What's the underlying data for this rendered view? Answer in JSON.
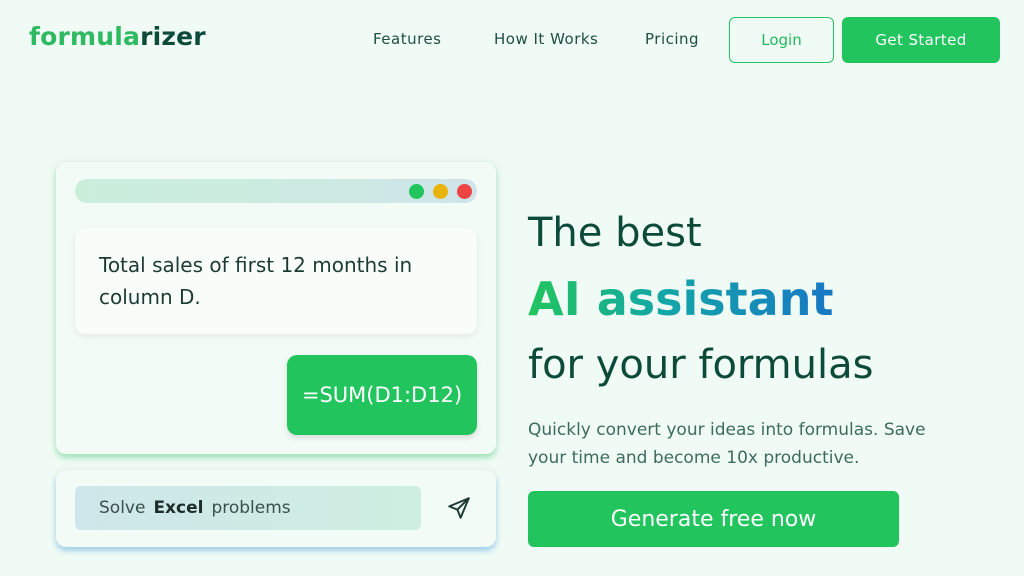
{
  "brand": {
    "part1": "formula",
    "part2": "rizer"
  },
  "nav": {
    "links": [
      "Features",
      "How It Works",
      "Pricing"
    ],
    "login": "Login",
    "get_started": "Get Started"
  },
  "demo": {
    "window_dots": [
      "#22c45e",
      "#eab308",
      "#ef4444"
    ],
    "question": "Total sales of first 12 months in column D.",
    "answer": "=SUM(D1:D12)",
    "input_prefix": "Solve",
    "input_keyword": "Excel",
    "input_suffix": "problems",
    "send_icon": "send-icon"
  },
  "hero": {
    "line1": "The best",
    "line2": "AI assistant",
    "line3": "for your formulas",
    "subtext": "Quickly convert your ideas into formulas. Save your time and become 10x productive.",
    "cta": "Generate free now"
  },
  "colors": {
    "accent": "#22c45e",
    "dark_text": "#0c4a3a"
  }
}
